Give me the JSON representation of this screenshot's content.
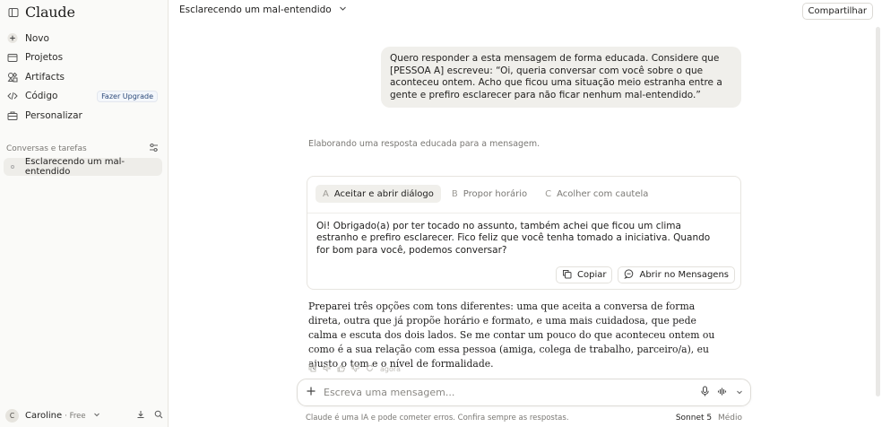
{
  "app": {
    "name": "Claude"
  },
  "sidebar": {
    "items": [
      {
        "label": "Novo",
        "icon": "plus-icon"
      },
      {
        "label": "Projetos",
        "icon": "folder-icon"
      },
      {
        "label": "Artifacts",
        "icon": "artifacts-icon"
      },
      {
        "label": "Código",
        "icon": "code-icon",
        "badge": "Fazer Upgrade"
      },
      {
        "label": "Personalizar",
        "icon": "briefcase-icon"
      }
    ],
    "section_title": "Conversas e tarefas",
    "conversations": [
      {
        "label": "Esclarecendo um mal-entendido"
      }
    ],
    "user": {
      "initial": "C",
      "name": "Caroline",
      "plan": "· Free"
    }
  },
  "header": {
    "title": "Esclarecendo um mal-entendido",
    "share_label": "Compartilhar"
  },
  "chat": {
    "user_message": "Quero responder a esta mensagem de forma educada. Considere que [PESSOA A] escreveu: “Oi, queria conversar com você sobre o que aconteceu ontem. Acho que ficou uma situação meio estranha entre a gente e prefiro esclarecer para não ficar nenhum mal-entendido.”",
    "thinking": "Elaborando uma resposta educada para a mensagem.",
    "options": {
      "tabs": [
        {
          "letter": "A",
          "label": "Aceitar e abrir diálogo",
          "active": true
        },
        {
          "letter": "B",
          "label": "Propor horário",
          "active": false
        },
        {
          "letter": "C",
          "label": "Acolher com cautela",
          "active": false
        }
      ],
      "text": "Oi! Obrigado(a) por ter tocado no assunto, também achei que ficou um clima estranho e prefiro esclarecer. Fico feliz que você tenha tomado a iniciativa. Quando for bom para você, podemos conversar?",
      "copy_label": "Copiar",
      "open_label": "Abrir no Mensagens"
    },
    "assistant_text": "Preparei três opções com tons diferentes: uma que aceita a conversa de forma direta, outra que já propõe horário e formato, e uma mais cuidadosa, que pede calma e escuta dos dois lados. Se me contar um pouco do que aconteceu ontem ou como é a sua relação com essa pessoa (amiga, colega de trabalho, parceiro/a), eu ajusto o tom e o nível de formalidade.",
    "timestamp": "agora"
  },
  "composer": {
    "placeholder": "Escreva uma mensagem...",
    "disclaimer": "Claude é uma IA e pode cometer erros. Confira sempre as respostas.",
    "model": "Sonnet 5",
    "model_mode": "Médio"
  }
}
